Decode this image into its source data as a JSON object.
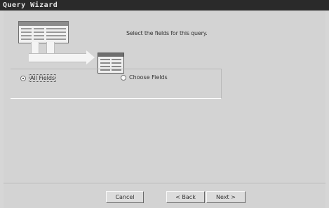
{
  "window": {
    "title": "Query Wizard"
  },
  "wizard": {
    "instruction": "Select the fields for this query.",
    "options": [
      {
        "label": "All Fields",
        "selected": true
      },
      {
        "label": "Choose Fields",
        "selected": false
      }
    ]
  },
  "buttons": {
    "cancel": "Cancel",
    "back": "< Back",
    "next": "Next >"
  },
  "icons": [
    "table-icon",
    "arrow-icon",
    "table-icon"
  ],
  "colors": {
    "titlebar": "#2a2a2a",
    "dialog_bg": "#d3d3d3"
  }
}
